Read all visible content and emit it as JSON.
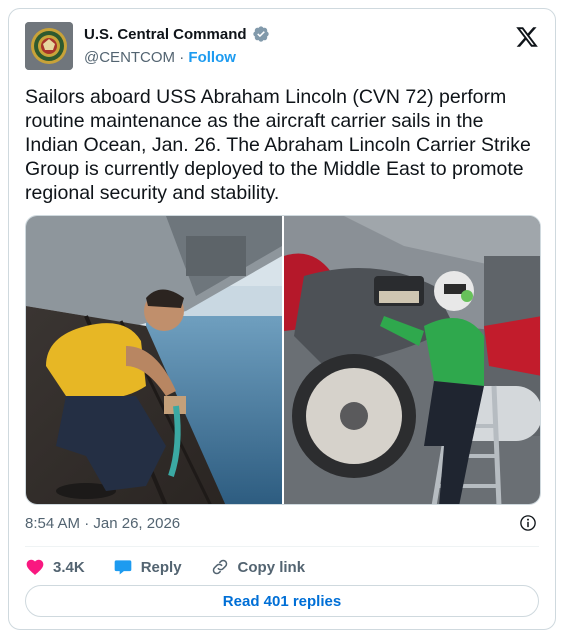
{
  "author": {
    "name": "U.S. Central Command",
    "handle": "@CENTCOM",
    "separator": "·",
    "follow_label": "Follow",
    "verified_color": "#829aab"
  },
  "post": {
    "text": "Sailors aboard USS Abraham Lincoln (CVN 72) perform routine maintenance as the aircraft carrier sails in the Indian Ocean, Jan. 26. The Abraham Lincoln Carrier Strike Group is currently deployed to the Middle East to promote regional security and stability.",
    "time": "8:54 AM",
    "date": "Jan 26, 2026"
  },
  "actions": {
    "likes": "3.4K",
    "reply_label": "Reply",
    "copy_link_label": "Copy link"
  },
  "footer": {
    "read_replies_label": "Read 401 replies"
  },
  "colors": {
    "accent": "#1d9bf0",
    "heart": "#f91880",
    "link": "#006fd6"
  },
  "icons": [
    "centcom-seal-icon",
    "verified-badge-icon",
    "x-logo-icon",
    "info-icon",
    "heart-icon",
    "reply-bubble-icon",
    "link-icon"
  ]
}
